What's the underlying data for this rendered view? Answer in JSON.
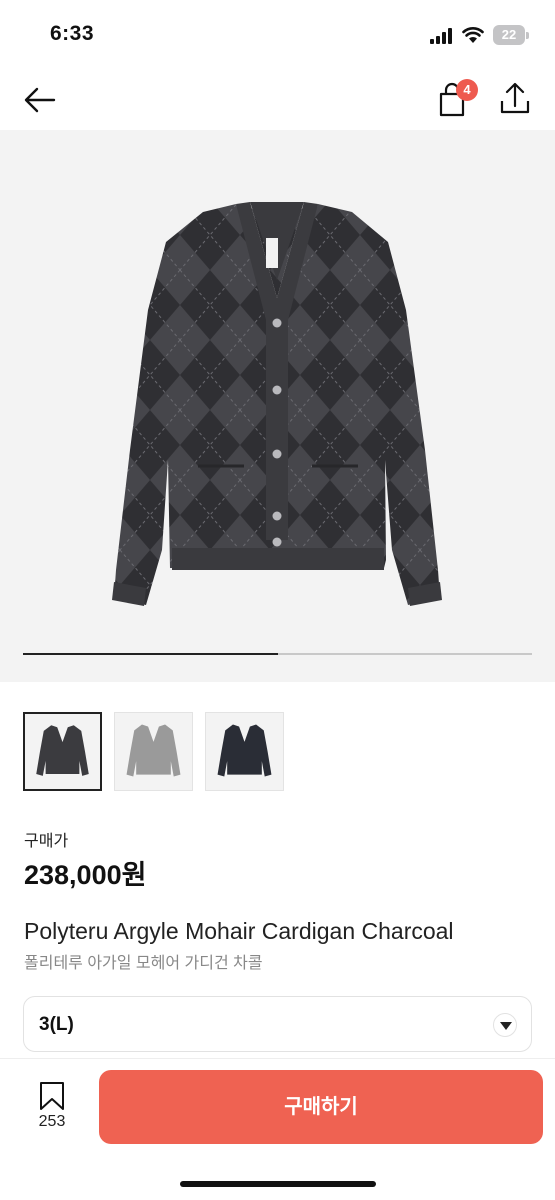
{
  "status": {
    "time": "6:33",
    "battery": "22"
  },
  "header": {
    "bag_count": "4"
  },
  "gallery": {
    "progress": 0.5,
    "thumbnail_count": 3,
    "active_index": 0
  },
  "product": {
    "price_label": "구매가",
    "price": "238,000원",
    "title_en": "Polyteru Argyle Mohair Cardigan Charcoal",
    "title_ko": "폴리테루 아가일 모헤어 가디건 차콜"
  },
  "option": {
    "selected": "3(L)"
  },
  "bottom": {
    "bookmark_count": "253",
    "buy_label": "구매하기"
  },
  "colors": {
    "accent": "#ef6252",
    "badge": "#ee5a4f",
    "charcoal": "#3b3b3f",
    "grey_variant": "#9a9a9a",
    "navy_variant": "#2a2d36"
  }
}
